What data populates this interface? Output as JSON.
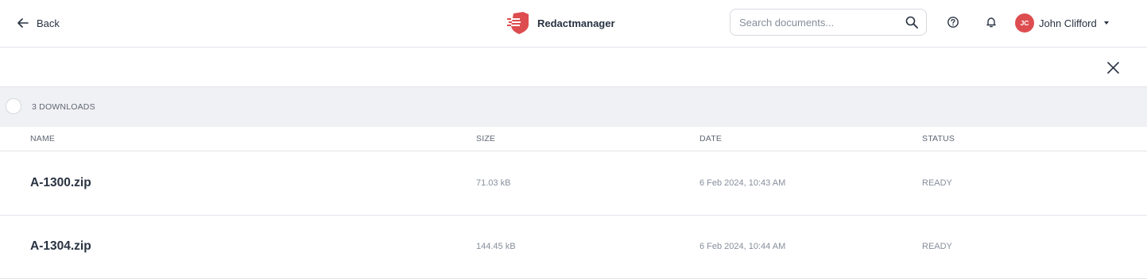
{
  "header": {
    "back_label": "Back",
    "app_name": "Redactmanager",
    "search": {
      "placeholder": "Search documents..."
    },
    "user": {
      "initials": "JC",
      "name": "John Clifford"
    },
    "colors": {
      "brand": "#dd4d50",
      "text": "#283241"
    },
    "icons": [
      "arrow-left-icon",
      "redaction-logo-icon",
      "search-icon",
      "help-icon",
      "bell-icon",
      "chevron-down-icon"
    ]
  },
  "downloads": {
    "count_label": "3 DOWNLOADS",
    "columns": {
      "name": "NAME",
      "size": "SIZE",
      "date": "DATE",
      "status": "STATUS"
    },
    "rows": [
      {
        "name": "A-1300.zip",
        "size": "71.03 kB",
        "date": "6 Feb 2024, 10:43 AM",
        "status": "READY"
      },
      {
        "name": "A-1304.zip",
        "size": "144.45 kB",
        "date": "6 Feb 2024, 10:44 AM",
        "status": "READY"
      }
    ]
  }
}
